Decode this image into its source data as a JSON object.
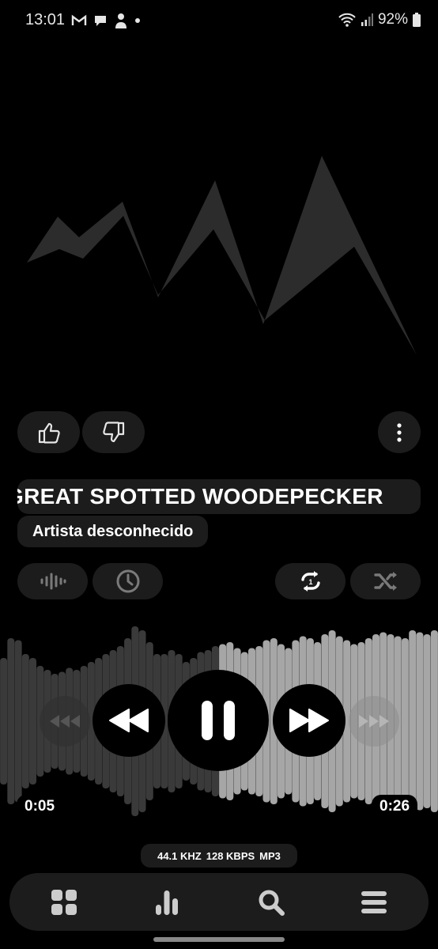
{
  "status": {
    "time": "13:01",
    "battery": "92%"
  },
  "track": {
    "title": "GREAT SPOTTED WOODEPECKER",
    "artist": "Artista desconhecido"
  },
  "playback": {
    "elapsed": "0:05",
    "duration": "0:26",
    "progress": 0.5,
    "state": "playing"
  },
  "audio_info": {
    "sample_rate": "44.1 KHZ",
    "bitrate": "128 KBPS",
    "format": "MP3"
  },
  "colors": {
    "background": "#000000",
    "pill": "#1c1c1c",
    "wave_played": "#3a3a3a",
    "wave_remaining": "#a6a6a6",
    "artwork": "#2c2c2c"
  },
  "icons": [
    "gmail-icon",
    "chat-icon",
    "person-icon",
    "wifi-icon",
    "signal-icon",
    "battery-icon",
    "thumbs-up-icon",
    "thumbs-down-icon",
    "more-vert-icon",
    "waveform-icon",
    "clock-icon",
    "repeat-one-icon",
    "shuffle-icon",
    "skip-back-icon",
    "rewind-icon",
    "pause-icon",
    "fast-forward-icon",
    "skip-forward-icon",
    "grid-icon",
    "bars-icon",
    "search-icon",
    "menu-icon"
  ]
}
